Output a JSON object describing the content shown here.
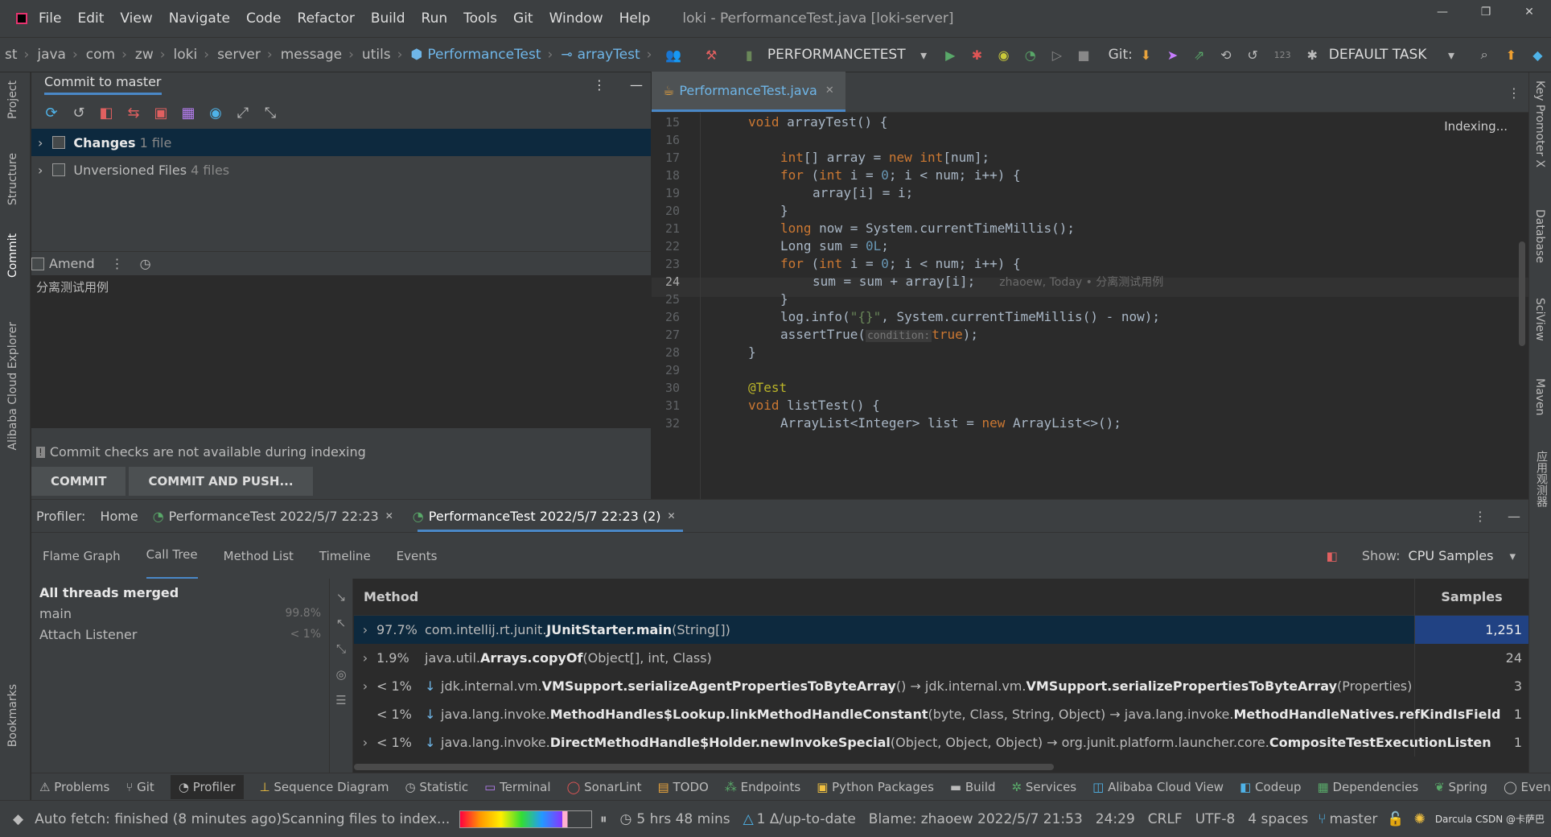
{
  "titlebar": {
    "menu": [
      "File",
      "Edit",
      "View",
      "Navigate",
      "Code",
      "Refactor",
      "Build",
      "Run",
      "Tools",
      "Git",
      "Window",
      "Help"
    ],
    "title": "loki - PerformanceTest.java [loki-server]"
  },
  "breadcrumbs": [
    "st",
    "java",
    "com",
    "zw",
    "loki",
    "server",
    "message",
    "utils",
    "PerformanceTest",
    "arrayTest"
  ],
  "toolbar": {
    "run_config": "PERFORMANCETEST",
    "git_label": "Git:",
    "task": "DEFAULT TASK",
    "counter": "123"
  },
  "left_tabs": [
    "Project",
    "Structure",
    "Commit",
    "Alibaba Cloud Explorer",
    "Bookmarks"
  ],
  "right_tabs": [
    "Key Promoter X",
    "Database",
    "SciView",
    "Maven",
    "应用观测器"
  ],
  "commit": {
    "header": "Commit to master",
    "changes_label": "Changes",
    "changes_count": "1 file",
    "unversioned_label": "Unversioned Files",
    "unversioned_count": "4 files",
    "amend_label": "Amend",
    "message": "分离测试用例",
    "warning": "Commit checks are not available during indexing",
    "commit_btn": "COMMIT",
    "commit_push_btn": "COMMIT AND PUSH..."
  },
  "editor": {
    "tab": "PerformanceTest.java",
    "indexing": "Indexing...",
    "inline_blame": "zhaoew, Today • 分离测试用例",
    "hint": "condition:",
    "lines": [
      "15",
      "16",
      "17",
      "18",
      "19",
      "20",
      "21",
      "22",
      "23",
      "24",
      "25",
      "26",
      "27",
      "28",
      "29",
      "30",
      "31",
      "32"
    ],
    "code": {
      "l15a": "void ",
      "l15b": "arrayTest() {",
      "l17a": "int",
      "l17b": "[] array = ",
      "l17c": "new ",
      "l17d": "int",
      "l17e": "[num];",
      "l18a": "for ",
      "l18b": "(",
      "l18c": "int ",
      "l18d": "i = ",
      "l18e": "0",
      "l18f": "; i < num; i++) {",
      "l19": "array[i] = i;",
      "l20": "}",
      "l21a": "long ",
      "l21b": "now = System.currentTimeMillis();",
      "l22a": "Long sum = ",
      "l22b": "0L",
      ";": ";",
      "l23a": "for ",
      "l23b": "(",
      "l23c": "int ",
      "l23d": "i = ",
      "l23e": "0",
      "l23f": "; i < num; i++) {",
      "l24": "sum = sum + array[i];",
      "l25": "}",
      "l26a": "log.info(",
      "l26b": "\"{}\"",
      "l26c": ", System.currentTimeMillis() - now);",
      "l27a": "assertTrue(",
      "l27b": "true",
      "l27c": ");",
      "l28": "}",
      "l30": "@Test",
      "l31a": "void ",
      "l31b": "listTest() {",
      "l32a": "ArrayList<Integer> list = ",
      "l32b": "new ",
      "l32c": "ArrayList<>();"
    }
  },
  "profiler": {
    "label": "Profiler:",
    "home": "Home",
    "tab1": "PerformanceTest 2022/5/7 22:23",
    "tab2": "PerformanceTest 2022/5/7 22:23 (2)",
    "subtabs": [
      "Flame Graph",
      "Call Tree",
      "Method List",
      "Timeline",
      "Events"
    ],
    "show_label": "Show:",
    "show_value": "CPU Samples",
    "threads": [
      {
        "name": "All threads merged",
        "pct": ""
      },
      {
        "name": "main",
        "pct": "99.8%"
      },
      {
        "name": "Attach Listener",
        "pct": "< 1%"
      }
    ],
    "col_method": "Method",
    "col_samples": "Samples",
    "rows": [
      {
        "pct": "97.7%",
        "pre": "com.intellij.rt.junit.",
        "bold": "JUnitStarter.main",
        "post": "(String[])",
        "bold2": "",
        "post2": "",
        "samples": "1,251",
        "arrow": "›",
        "down": ""
      },
      {
        "pct": "1.9%",
        "pre": "java.util.",
        "bold": "Arrays.copyOf",
        "post": "(Object[], int, Class)",
        "bold2": "",
        "post2": "",
        "samples": "24",
        "arrow": "›",
        "down": ""
      },
      {
        "pct": "< 1%",
        "pre": "jdk.internal.vm.",
        "bold": "VMSupport.serializeAgentPropertiesToByteArray",
        "post": "() → jdk.internal.vm.",
        "bold2": "VMSupport.serializePropertiesToByteArray",
        "post2": "(Properties)",
        "samples": "3",
        "arrow": "›",
        "down": "↓"
      },
      {
        "pct": "< 1%",
        "pre": "java.lang.invoke.",
        "bold": "MethodHandles$Lookup.linkMethodHandleConstant",
        "post": "(byte, Class, String, Object) → java.lang.invoke.",
        "bold2": "MethodHandleNatives.refKindIsField",
        "post2": "",
        "samples": "1",
        "arrow": "",
        "down": "↓"
      },
      {
        "pct": "< 1%",
        "pre": "java.lang.invoke.",
        "bold": "DirectMethodHandle$Holder.newInvokeSpecial",
        "post": "(Object, Object, Object) → org.junit.platform.launcher.core.",
        "bold2": "CompositeTestExecutionListen",
        "post2": "",
        "samples": "1",
        "arrow": "›",
        "down": "↓"
      }
    ]
  },
  "toolwindows": [
    "Problems",
    "Git",
    "Profiler",
    "Sequence Diagram",
    "Statistic",
    "Terminal",
    "SonarLint",
    "TODO",
    "Endpoints",
    "Python Packages",
    "Build",
    "Services",
    "Alibaba Cloud View",
    "Codeup",
    "Dependencies",
    "Spring",
    "Event"
  ],
  "status": {
    "left": "Auto fetch: finished (8 minutes ago)",
    "scanning": "Scanning files to index...",
    "time": "5 hrs 48 mins",
    "vcs": "1 Δ/up-to-date",
    "blame": "Blame: zhaoew 2022/5/7 21:53",
    "pos": "24:29",
    "crlf": "CRLF",
    "enc": "UTF-8",
    "indent": "4 spaces",
    "branch": "master",
    "theme": "Darcula",
    "watermark": "CSDN @卡萨巴"
  },
  "colors": {
    "accent": "#4a88c7",
    "selection": "#0d293e",
    "keyword": "#cc7832",
    "number": "#6897b4"
  }
}
